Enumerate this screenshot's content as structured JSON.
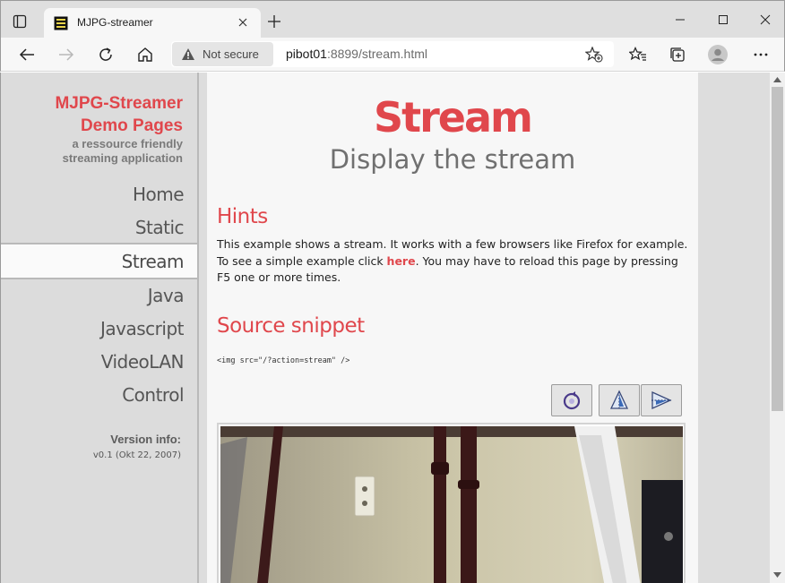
{
  "browser": {
    "tab": {
      "title": "MJPG-streamer",
      "favicon": "mjpg-favicon"
    },
    "address": {
      "security_label": "Not secure",
      "url_host": "pibot01",
      "url_rest": ":8899/stream.html"
    }
  },
  "sidebar": {
    "brand_line1": "MJPG-Streamer",
    "brand_line2": "Demo Pages",
    "brand_sub1": "a ressource friendly",
    "brand_sub2": "streaming application",
    "nav": [
      {
        "label": "Home"
      },
      {
        "label": "Static"
      },
      {
        "label": "Stream"
      },
      {
        "label": "Java"
      },
      {
        "label": "Javascript"
      },
      {
        "label": "VideoLAN"
      },
      {
        "label": "Control"
      }
    ],
    "version_label": "Version info:",
    "version_value": "v0.1 (Okt 22, 2007)"
  },
  "main": {
    "title": "Stream",
    "subtitle": "Display the stream",
    "hints_heading": "Hints",
    "hints_line1": "This example shows a stream. It works with a few browsers like Firefox for example.",
    "hints_pre_link": "To see a simple example click ",
    "hints_link": "here",
    "hints_post_link": ". You may have to reload this page by pressing",
    "hints_line3": "F5 one or more times.",
    "snippet_heading": "Source snippet",
    "snippet_code": "<img src=\"/?action=stream\" />"
  },
  "colors": {
    "accent": "#e0474c",
    "text_gray": "#707070"
  },
  "icons": {
    "controls": [
      "rotate-icon",
      "flip-vertical-icon",
      "flip-horizontal-icon"
    ]
  }
}
